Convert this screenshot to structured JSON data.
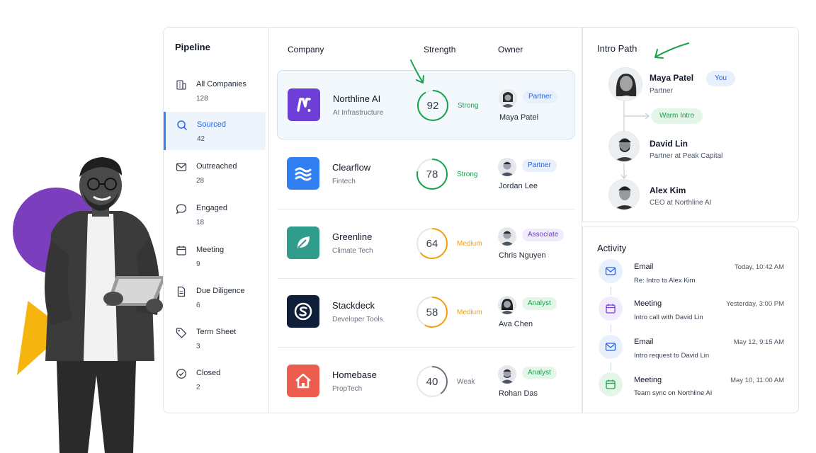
{
  "sidebar": {
    "title": "Pipeline",
    "items": [
      {
        "label": "All Companies",
        "count": "128",
        "icon": "building-icon"
      },
      {
        "label": "Sourced",
        "count": "42",
        "icon": "search-icon"
      },
      {
        "label": "Outreached",
        "count": "28",
        "icon": "mail-icon"
      },
      {
        "label": "Engaged",
        "count": "18",
        "icon": "chat-bubble-icon"
      },
      {
        "label": "Meeting",
        "count": "9",
        "icon": "calendar-icon"
      },
      {
        "label": "Due Diligence",
        "count": "6",
        "icon": "document-icon"
      },
      {
        "label": "Term Sheet",
        "count": "3",
        "icon": "tag-icon"
      },
      {
        "label": "Closed",
        "count": "2",
        "icon": "check-circle-icon"
      }
    ],
    "active_index": 1
  },
  "table": {
    "headers": {
      "company": "Company",
      "strength": "Strength",
      "owner": "Owner"
    },
    "rows": [
      {
        "name": "Northline AI",
        "sector": "AI Infrastructure",
        "score": "92",
        "score_fraction": 0.92,
        "strength": "Strong",
        "owner": "Maya Patel",
        "role": "Partner",
        "logo_color": "#6d3fd6",
        "logo_icon": "n-logo-icon"
      },
      {
        "name": "Clearflow",
        "sector": "Fintech",
        "score": "78",
        "score_fraction": 0.78,
        "strength": "Strong",
        "owner": "Jordan Lee",
        "role": "Partner",
        "logo_color": "#2f7ff0",
        "logo_icon": "wave-logo-icon"
      },
      {
        "name": "Greenline",
        "sector": "Climate Tech",
        "score": "64",
        "score_fraction": 0.64,
        "strength": "Medium",
        "owner": "Chris Nguyen",
        "role": "Associate",
        "logo_color": "#2f9c8c",
        "logo_icon": "leaf-logo-icon"
      },
      {
        "name": "Stackdeck",
        "sector": "Developer Tools",
        "score": "58",
        "score_fraction": 0.58,
        "strength": "Medium",
        "owner": "Ava Chen",
        "role": "Analyst",
        "logo_color": "#0f1f3a",
        "logo_icon": "s-logo-icon"
      },
      {
        "name": "Homebase",
        "sector": "PropTech",
        "score": "40",
        "score_fraction": 0.4,
        "strength": "Weak",
        "owner": "Rohan Das",
        "role": "Analyst",
        "logo_color": "#ec5d4f",
        "logo_icon": "house-logo-icon"
      }
    ]
  },
  "intro_path": {
    "title": "Intro Path",
    "you_label": "You",
    "warm_intro_label": "Warm Intro",
    "nodes": [
      {
        "name": "Maya Patel",
        "subtitle": "Partner"
      },
      {
        "name": "David Lin",
        "subtitle": "Partner at Peak Capital"
      },
      {
        "name": "Alex Kim",
        "subtitle": "CEO at Northline AI"
      }
    ]
  },
  "activity": {
    "title": "Activity",
    "items": [
      {
        "type": "Email",
        "description": "Re: Intro to Alex Kim",
        "time": "Today, 10:42 AM",
        "icon": "mail-icon"
      },
      {
        "type": "Meeting",
        "description": "Intro call with David Lin",
        "time": "Yesterday, 3:00 PM",
        "icon": "calendar-icon"
      },
      {
        "type": "Email",
        "description": "Intro request to David Lin",
        "time": "May 12, 9:15 AM",
        "icon": "mail-icon"
      },
      {
        "type": "Meeting",
        "description": "Team sync on Northline AI",
        "time": "May 10, 11:00 AM",
        "icon": "calendar-icon"
      }
    ]
  },
  "colors": {
    "accent_blue": "#2563eb",
    "strong": "#16a34a",
    "medium": "#f59e0b",
    "weak": "#6b7280",
    "purple_decor": "#7b3fbe",
    "yellow_decor": "#f6b40e",
    "annotation_green": "#16a34a"
  }
}
